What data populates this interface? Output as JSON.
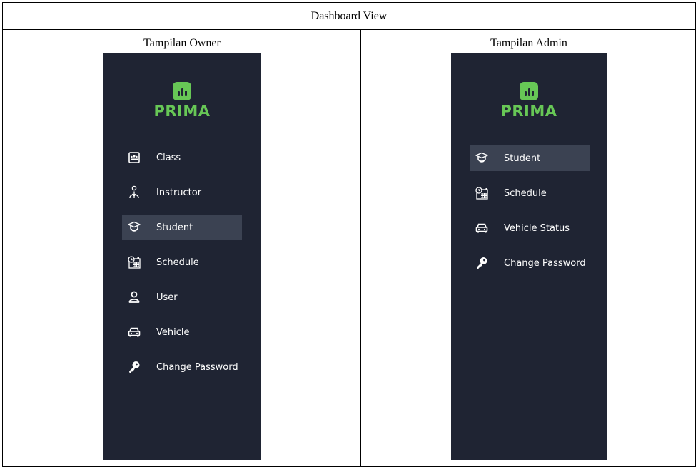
{
  "header": {
    "title": "Dashboard View"
  },
  "owner": {
    "title": "Tampilan Owner",
    "logo": "PRIMA",
    "items": [
      {
        "label": "Class",
        "icon": "class-icon",
        "active": false
      },
      {
        "label": "Instructor",
        "icon": "instructor-icon",
        "active": false
      },
      {
        "label": "Student",
        "icon": "student-icon",
        "active": true
      },
      {
        "label": "Schedule",
        "icon": "schedule-icon",
        "active": false
      },
      {
        "label": "User",
        "icon": "user-icon",
        "active": false
      },
      {
        "label": "Vehicle",
        "icon": "vehicle-icon",
        "active": false
      },
      {
        "label": "Change Password",
        "icon": "key-icon",
        "active": false
      }
    ]
  },
  "admin": {
    "title": "Tampilan Admin",
    "logo": "PRIMA",
    "items": [
      {
        "label": "Student",
        "icon": "student-icon",
        "active": true
      },
      {
        "label": "Schedule",
        "icon": "schedule-icon",
        "active": false
      },
      {
        "label": "Vehicle Status",
        "icon": "vehicle-icon",
        "active": false
      },
      {
        "label": "Change Password",
        "icon": "key-icon",
        "active": false
      }
    ]
  },
  "colors": {
    "sidebar_bg": "#1f2433",
    "active_bg": "#3b4252",
    "brand_green": "#67c756",
    "text": "#ffffff"
  }
}
